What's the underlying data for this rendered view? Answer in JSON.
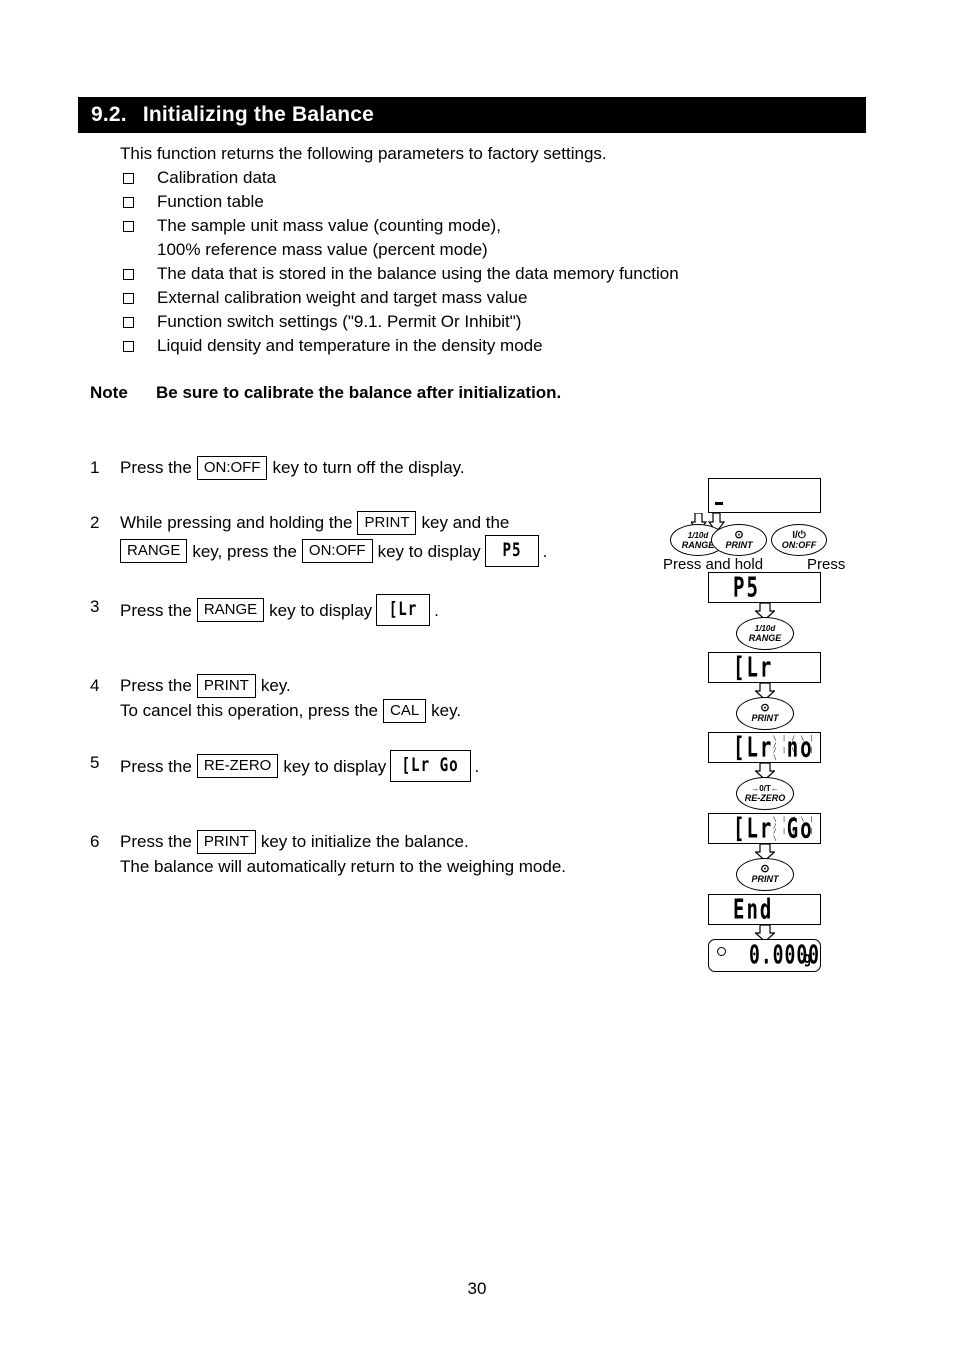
{
  "header": {
    "number": "9.2.",
    "title": "Initializing the Balance"
  },
  "intro": "This function returns the following parameters to factory settings.",
  "bullets": [
    {
      "line1": "Calibration data",
      "line2": ""
    },
    {
      "line1": "Function table",
      "line2": ""
    },
    {
      "line1": "The sample unit mass value (counting mode),",
      "line2": "100% reference mass value (percent mode)"
    },
    {
      "line1": "The data that is stored in the balance using the data memory function",
      "line2": ""
    },
    {
      "line1": "External calibration weight and target mass value",
      "line2": ""
    },
    {
      "line1": "Function switch settings (\"9.1. Permit Or Inhibit\")",
      "line2": ""
    },
    {
      "line1": "Liquid density and temperature in the density mode",
      "line2": ""
    }
  ],
  "note": {
    "label": "Note",
    "text": "Be sure to calibrate the balance after initialization."
  },
  "steps": [
    {
      "num": "1",
      "l1a": "Press the",
      "l1key": "ON:OFF",
      "l1b": "key to turn off the display.",
      "l2a": "",
      "l2key": "",
      "l2b": ""
    },
    {
      "num": "2",
      "l1a": "While pressing and holding the",
      "l1key": "PRINT",
      "l1b": "key and the",
      "l2key": "RANGE",
      "l2a": "key, press the",
      "l2key2": "ON:OFF",
      "l2b": "key to display",
      "l2seg": "P5",
      "l2end": "."
    },
    {
      "num": "3",
      "l1a": "Press the",
      "l1key": "RANGE",
      "l1b": "key to display",
      "l1seg": "[Lr",
      "l1end": "."
    },
    {
      "num": "4",
      "l1a": "Press the",
      "l1key": "PRINT",
      "l1b": "key.",
      "l2a": "To cancel this operation, press the",
      "l2key": "CAL",
      "l2b": "key."
    },
    {
      "num": "5",
      "l1a": "Press the",
      "l1key": "RE-ZERO",
      "l1b": "key to display",
      "l1seg": "[Lr  Go",
      "l1end": "."
    },
    {
      "num": "6",
      "l1a": "Press the",
      "l1key": "PRINT",
      "l1b": "key to initialize the balance.",
      "l2a": "The balance will automatically return to the weighing mode."
    }
  ],
  "diagram": {
    "displays": [
      {
        "value": "",
        "state": "off",
        "unit": "",
        "blink": false
      },
      {
        "value": "P5",
        "state": "on",
        "unit": "",
        "blink": false
      },
      {
        "value": "[Lr",
        "state": "on",
        "unit": "",
        "blink": false
      },
      {
        "value": "[Lr  no",
        "state": "on",
        "unit": "",
        "blink": true
      },
      {
        "value": "[Lr  Go",
        "state": "on",
        "unit": "",
        "blink": true
      },
      {
        "value": "End",
        "state": "on",
        "unit": "",
        "blink": false
      },
      {
        "value": "0.0000",
        "state": "final",
        "unit": "g",
        "blink": false
      }
    ],
    "keys": {
      "range": {
        "top": "1/10d",
        "bottom": "RANGE"
      },
      "print": {
        "top": "⊙",
        "bottom": "PRINT"
      },
      "onoff": {
        "top": "I/⏻",
        "bottom": "ON:OFF"
      },
      "rezero": {
        "top": "→0/T←",
        "bottom": "RE-ZERO"
      }
    },
    "captions": {
      "press_and_hold": "Press and hold",
      "press": "Press"
    }
  },
  "page_number": "30"
}
